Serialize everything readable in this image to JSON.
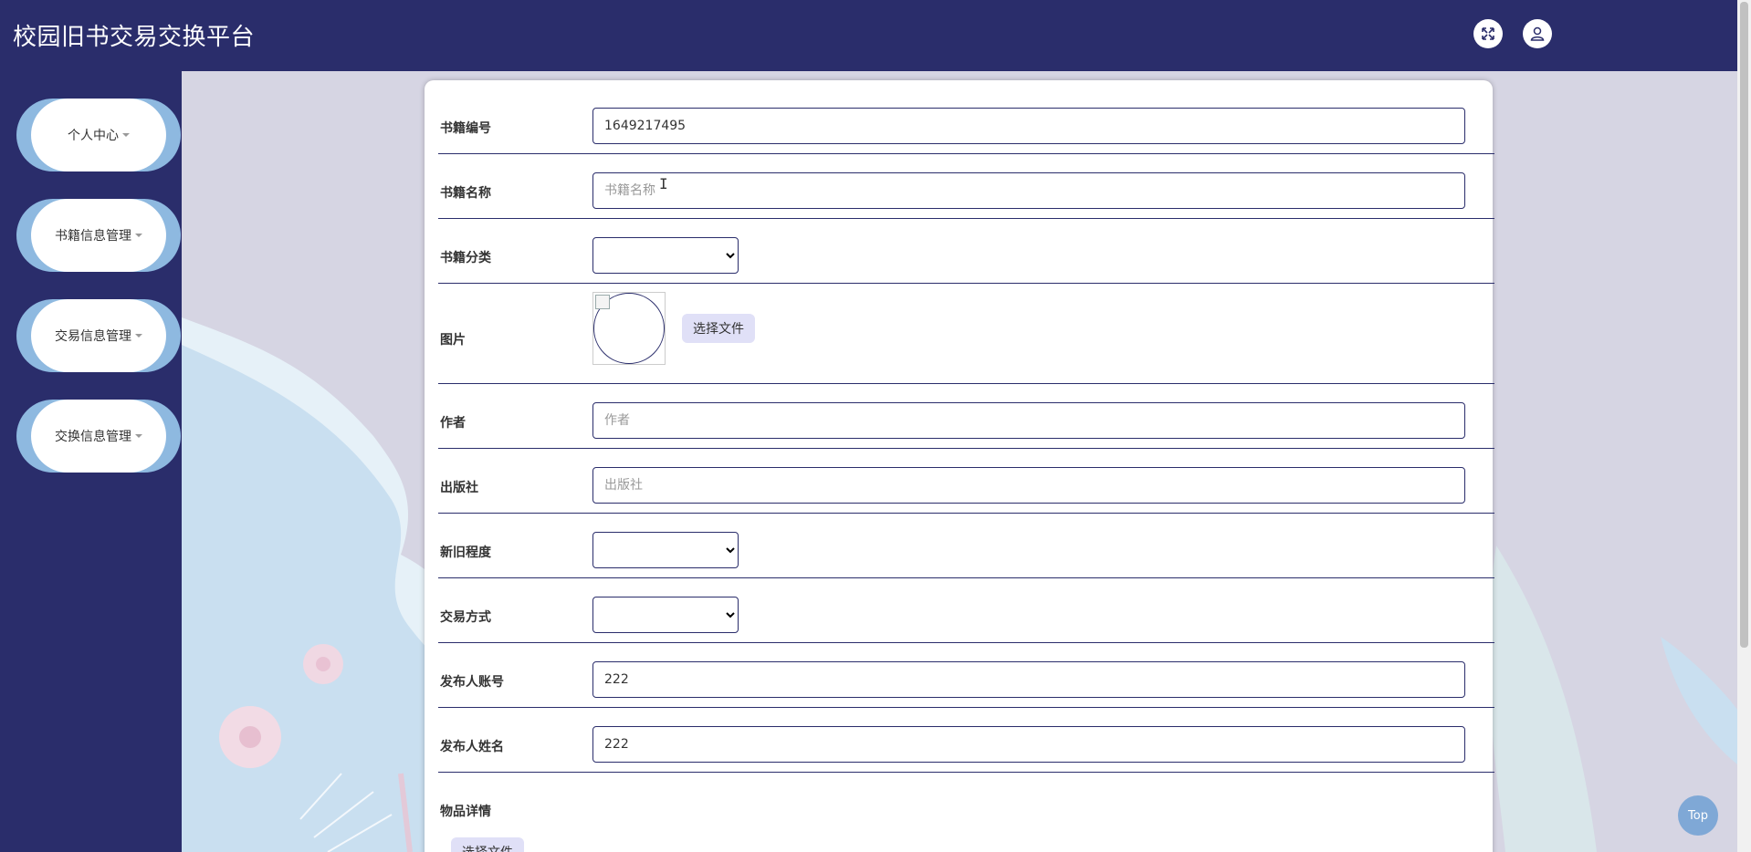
{
  "header": {
    "title": "校园旧书交易交换平台",
    "fullscreen_icon": "expand-arrows-icon",
    "user_icon": "user-icon"
  },
  "sidebar": {
    "items": [
      {
        "label": "个人中心"
      },
      {
        "label": "书籍信息管理"
      },
      {
        "label": "交易信息管理"
      },
      {
        "label": "交换信息管理"
      }
    ]
  },
  "form": {
    "book_number": {
      "label": "书籍编号",
      "value": "1649217495"
    },
    "book_name": {
      "label": "书籍名称",
      "placeholder": "书籍名称",
      "value": ""
    },
    "book_category": {
      "label": "书籍分类",
      "value": ""
    },
    "image": {
      "label": "图片",
      "button": "选择文件"
    },
    "author": {
      "label": "作者",
      "placeholder": "作者",
      "value": ""
    },
    "publisher": {
      "label": "出版社",
      "placeholder": "出版社",
      "value": ""
    },
    "condition": {
      "label": "新旧程度",
      "value": ""
    },
    "trade_method": {
      "label": "交易方式",
      "value": ""
    },
    "publisher_account": {
      "label": "发布人账号",
      "value": "222"
    },
    "publisher_name": {
      "label": "发布人姓名",
      "value": "222"
    },
    "item_details": {
      "label": "物品详情",
      "button": "选择文件"
    }
  },
  "top_button": "Top",
  "colors": {
    "primary": "#2a2d6b",
    "nav_accent": "#8eb9e0",
    "main_bg": "#d6d5e3",
    "file_button_bg": "#e0e0f7",
    "top_button_bg": "#7fa8d6"
  }
}
